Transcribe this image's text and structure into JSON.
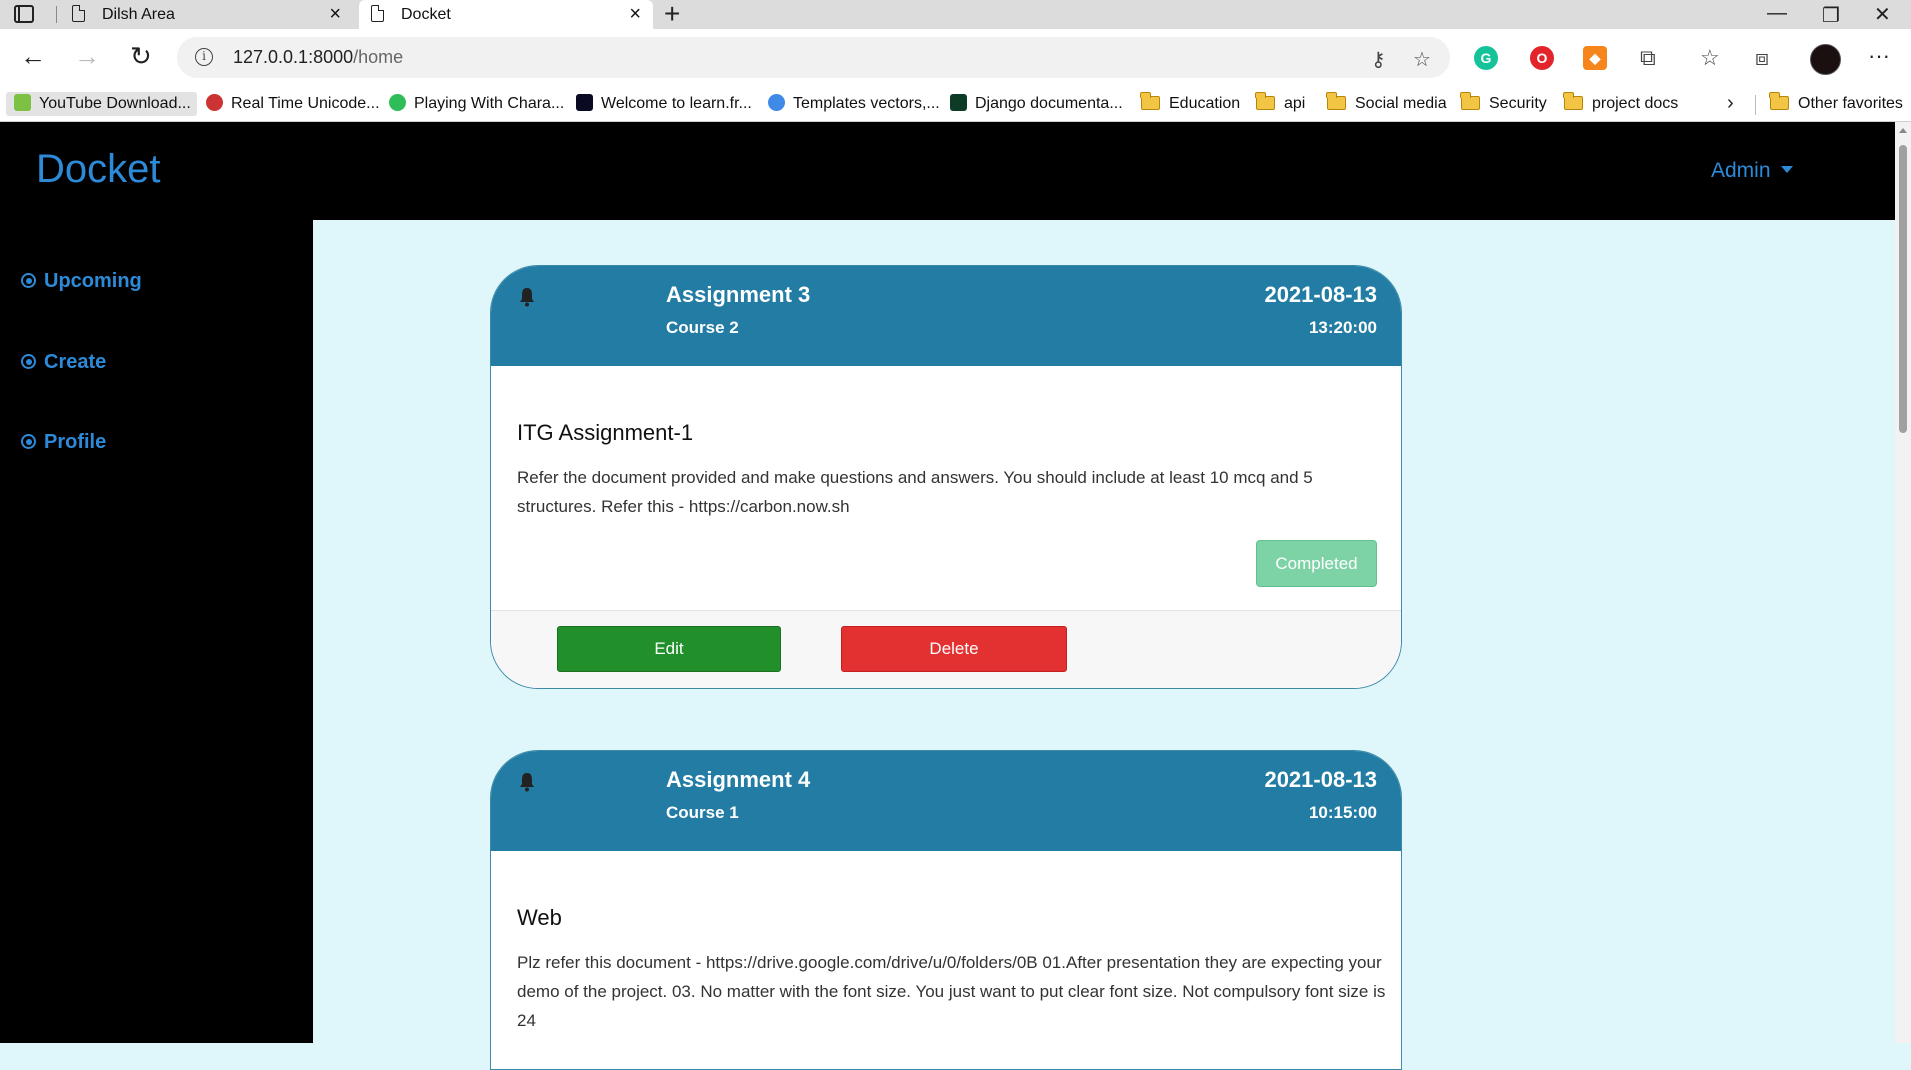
{
  "browser": {
    "tabs": [
      {
        "title": "Dilsh Area",
        "active": false
      },
      {
        "title": "Docket",
        "active": true
      }
    ],
    "url": {
      "host": "127.0.0.1:8000",
      "path": "/home"
    },
    "bookmarks": [
      {
        "label": "YouTube Download...",
        "icon": "download-icon"
      },
      {
        "label": "Real Time Unicode...",
        "icon": "unicode-icon"
      },
      {
        "label": "Playing With Chara...",
        "icon": "h-logo-icon"
      },
      {
        "label": "Welcome to learn.fr...",
        "icon": "code-icon"
      },
      {
        "label": "Templates vectors,...",
        "icon": "freepik-icon"
      },
      {
        "label": "Django documenta...",
        "icon": "django-icon"
      },
      {
        "label": "Education",
        "icon": "folder-icon"
      },
      {
        "label": "api",
        "icon": "folder-icon"
      },
      {
        "label": "Social media",
        "icon": "folder-icon"
      },
      {
        "label": "Security",
        "icon": "folder-icon"
      },
      {
        "label": "project docs",
        "icon": "folder-icon"
      }
    ],
    "other_favorites": "Other favorites"
  },
  "app": {
    "brand": "Docket",
    "user_menu": "Admin",
    "accent": "#2d8ad8",
    "sidebar": [
      {
        "label": "Upcoming"
      },
      {
        "label": "Create"
      },
      {
        "label": "Profile"
      }
    ]
  },
  "assignments": [
    {
      "title": "Assignment 3",
      "course": "Course 2",
      "date": "2021-08-13",
      "time": "13:20:00",
      "name": "ITG Assignment-1",
      "description": "Refer the document provided and make questions and answers. You should include at least 10 mcq and 5 structures. Refer this - https://carbon.now.sh",
      "status": "Completed",
      "edit_label": "Edit",
      "delete_label": "Delete"
    },
    {
      "title": "Assignment 4",
      "course": "Course 1",
      "date": "2021-08-13",
      "time": "10:15:00",
      "name": "Web",
      "description": "Plz refer this document - https://drive.google.com/drive/u/0/folders/0B 01.After presentation they are expecting your demo of the project. 03. No matter with the font size. You just want to put clear font size. Not compulsory font size is 24"
    }
  ]
}
